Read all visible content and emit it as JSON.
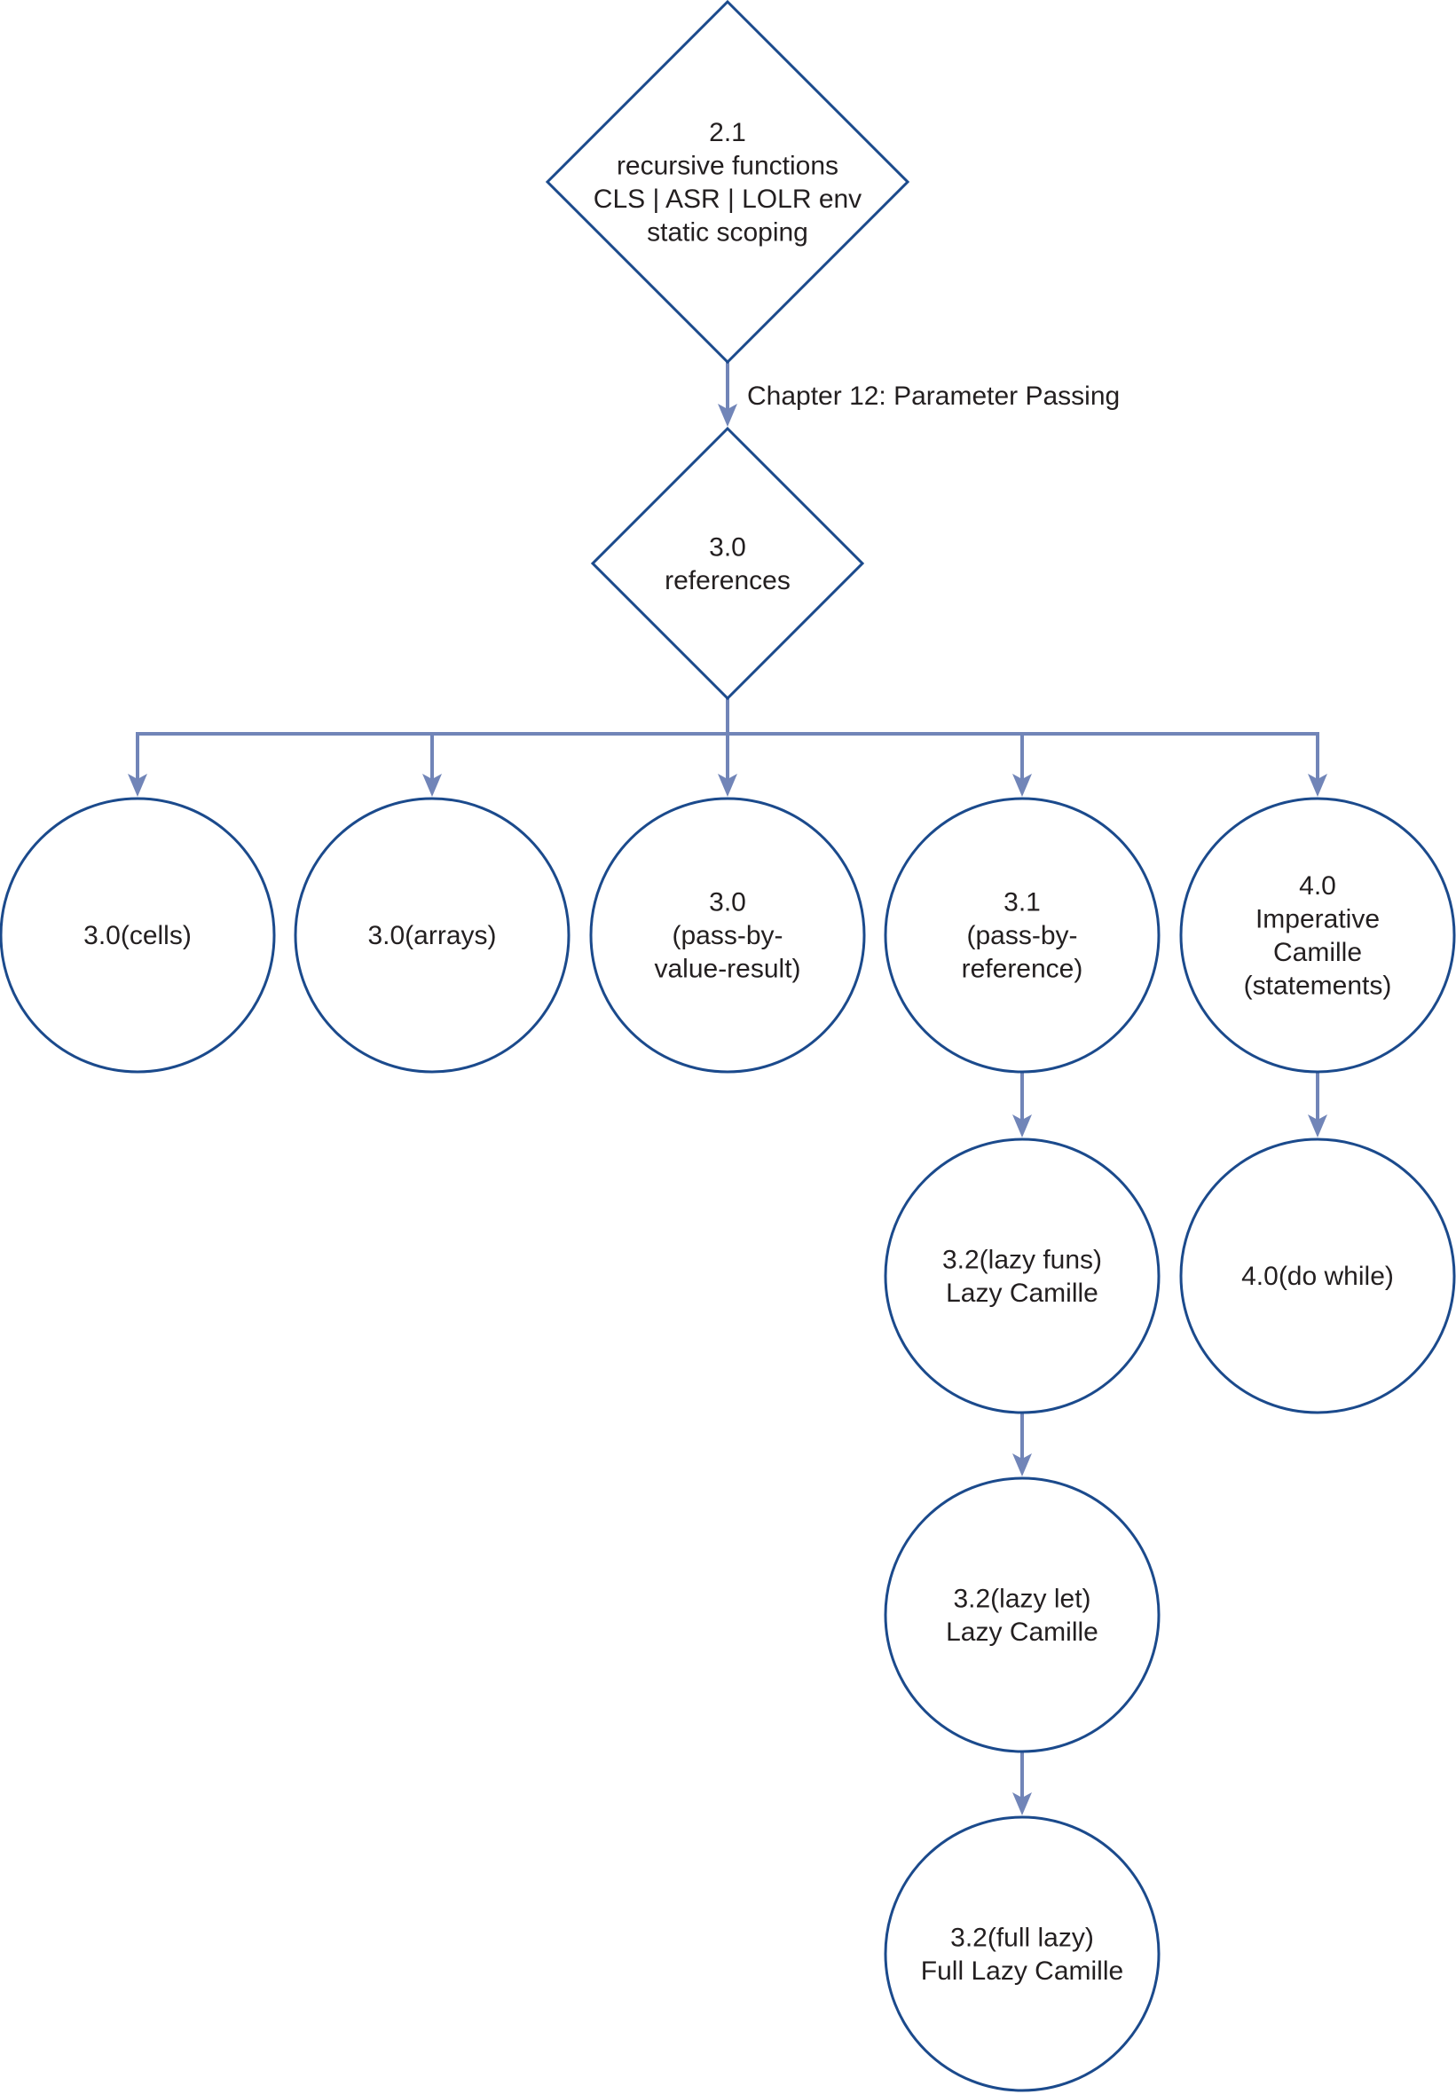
{
  "colors": {
    "shape_stroke": "#1b4a8c",
    "edge": "#7185b8",
    "text": "#231f20"
  },
  "nodes": [
    {
      "id": "n21",
      "shape": "diamond",
      "lines": [
        "2.1",
        "recursive functions",
        "CLS | ASR | LOLR env",
        "static scoping"
      ]
    },
    {
      "id": "n30",
      "shape": "diamond",
      "lines": [
        "3.0",
        "references"
      ]
    },
    {
      "id": "cells",
      "shape": "circle",
      "lines": [
        "3.0(cells)"
      ]
    },
    {
      "id": "arrays",
      "shape": "circle",
      "lines": [
        "3.0(arrays)"
      ]
    },
    {
      "id": "pbvr",
      "shape": "circle",
      "lines": [
        "3.0",
        "(pass-by-",
        "value-result)"
      ]
    },
    {
      "id": "pbr",
      "shape": "circle",
      "lines": [
        "3.1",
        "(pass-by-",
        "reference)"
      ]
    },
    {
      "id": "imp",
      "shape": "circle",
      "lines": [
        "4.0",
        "Imperative",
        "Camille",
        "(statements)"
      ]
    },
    {
      "id": "lazyfuns",
      "shape": "circle",
      "lines": [
        "3.2(lazy funs)",
        "Lazy Camille"
      ]
    },
    {
      "id": "dowhile",
      "shape": "circle",
      "lines": [
        "4.0(do while)"
      ]
    },
    {
      "id": "lazylet",
      "shape": "circle",
      "lines": [
        "3.2(lazy let)",
        "Lazy Camille"
      ]
    },
    {
      "id": "fulllazy",
      "shape": "circle",
      "lines": [
        "3.2(full lazy)",
        "Full Lazy Camille"
      ]
    }
  ],
  "edges": [
    {
      "from": "n21",
      "to": "n30",
      "label": "Chapter 12: Parameter Passing"
    },
    {
      "from": "n30",
      "to": "cells"
    },
    {
      "from": "n30",
      "to": "arrays"
    },
    {
      "from": "n30",
      "to": "pbvr"
    },
    {
      "from": "n30",
      "to": "pbr"
    },
    {
      "from": "n30",
      "to": "imp"
    },
    {
      "from": "pbr",
      "to": "lazyfuns"
    },
    {
      "from": "imp",
      "to": "dowhile"
    },
    {
      "from": "lazyfuns",
      "to": "lazylet"
    },
    {
      "from": "lazylet",
      "to": "fulllazy"
    }
  ]
}
